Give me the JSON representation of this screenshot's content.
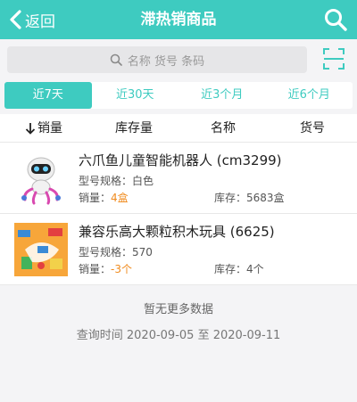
{
  "header": {
    "back_label": "返回",
    "title": "滞热销商品"
  },
  "search": {
    "placeholder": "名称 货号 条码"
  },
  "tabs": [
    {
      "label": "近7天",
      "active": true
    },
    {
      "label": "近30天",
      "active": false
    },
    {
      "label": "近3个月",
      "active": false
    },
    {
      "label": "近6个月",
      "active": false
    }
  ],
  "columns": {
    "sales": "销量",
    "stock": "库存量",
    "name": "名称",
    "code": "货号"
  },
  "items": [
    {
      "name": "六爪鱼儿童智能机器人 (cm3299)",
      "spec_label": "型号规格：",
      "spec": "白色",
      "sales_label": "销量：",
      "sales": "4盒",
      "stock_label": "库存：",
      "stock": "5683盒"
    },
    {
      "name": "兼容乐高大颗粒积木玩具 (6625)",
      "spec_label": "型号规格：",
      "spec": "570",
      "sales_label": "销量：",
      "sales": "-3个",
      "stock_label": "库存：",
      "stock": "4个"
    }
  ],
  "footer": {
    "no_more": "暂无更多数据",
    "query_time": "查询时间 2020-09-05 至 2020-09-11"
  },
  "colors": {
    "accent": "#3ecbc0",
    "sales_value": "#f08b1e"
  }
}
